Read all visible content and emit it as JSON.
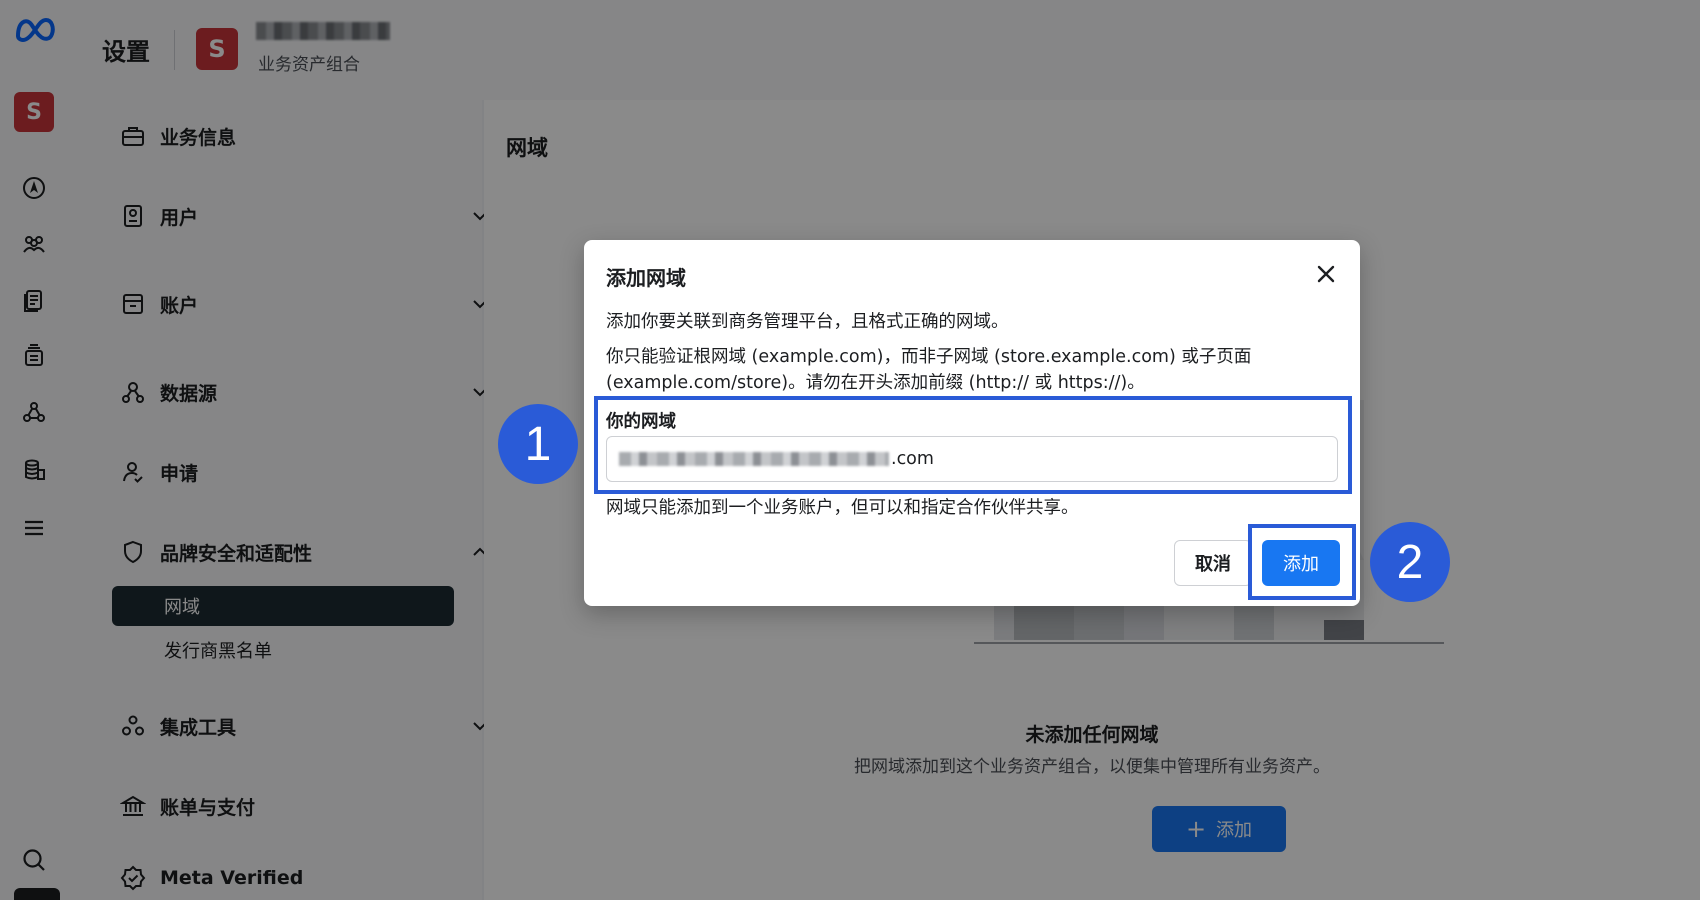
{
  "header": {
    "title": "设置",
    "business_avatar_letter": "S",
    "business_subtitle": "业务资产组合"
  },
  "rail": {
    "avatar_letter": "S",
    "icons": [
      "meta-logo-icon",
      "compass-icon",
      "people-icon",
      "document-icon",
      "layers-icon",
      "connections-icon",
      "stack-icon",
      "menu-icon",
      "search-icon"
    ]
  },
  "sidebar": {
    "items": [
      {
        "label": "业务信息",
        "icon": "briefcase-icon"
      },
      {
        "label": "用户",
        "icon": "badge-icon"
      },
      {
        "label": "账户",
        "icon": "folder-icon"
      },
      {
        "label": "数据源",
        "icon": "data-icon"
      },
      {
        "label": "申请",
        "icon": "person-check-icon"
      },
      {
        "label": "品牌安全和适配性",
        "icon": "shield-icon"
      },
      {
        "label": "集成工具",
        "icon": "integration-icon"
      },
      {
        "label": "账单与支付",
        "icon": "bank-icon"
      },
      {
        "label": "Meta Verified",
        "icon": "verified-icon"
      }
    ],
    "subitems": [
      {
        "label": "网域",
        "active": true
      },
      {
        "label": "发行商黑名单",
        "active": false
      }
    ]
  },
  "content": {
    "title": "网域",
    "empty_title": "未添加任何网域",
    "empty_desc": "把网域添加到这个业务资产组合，以便集中管理所有业务资产。",
    "add_button": "添加"
  },
  "modal": {
    "title": "添加网域",
    "para1": "添加你要关联到商务管理平台，且格式正确的网域。",
    "para2": "你只能验证根网域 (example.com)，而非子网域 (store.example.com) 或子页面 (example.com/store)。请勿在开头添加前缀 (http:// 或 https://)。",
    "field_label": "你的网域",
    "field_value_suffix": ".com",
    "help": "网域只能添加到一个业务账户，但可以和指定合作伙伴共享。",
    "cancel": "取消",
    "add": "添加"
  },
  "callouts": {
    "one": "1",
    "two": "2",
    "color": "#2a5bd7"
  }
}
